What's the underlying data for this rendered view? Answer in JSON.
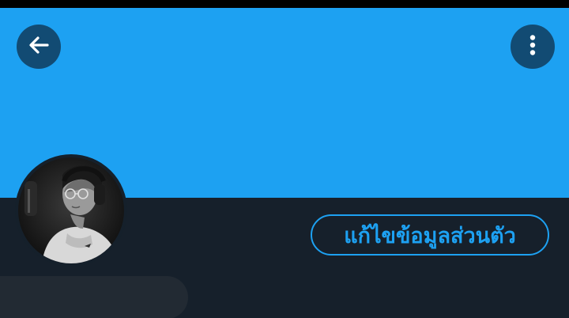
{
  "header": {
    "back_icon": "arrow-left-icon",
    "more_icon": "more-vertical-icon"
  },
  "profile": {
    "edit_button_label": "แก้ไขข้อมูลส่วนตัว"
  },
  "colors": {
    "banner": "#1da1f2",
    "background": "#15202b",
    "accent": "#1da1f2",
    "icon_button_bg": "#124b73"
  }
}
